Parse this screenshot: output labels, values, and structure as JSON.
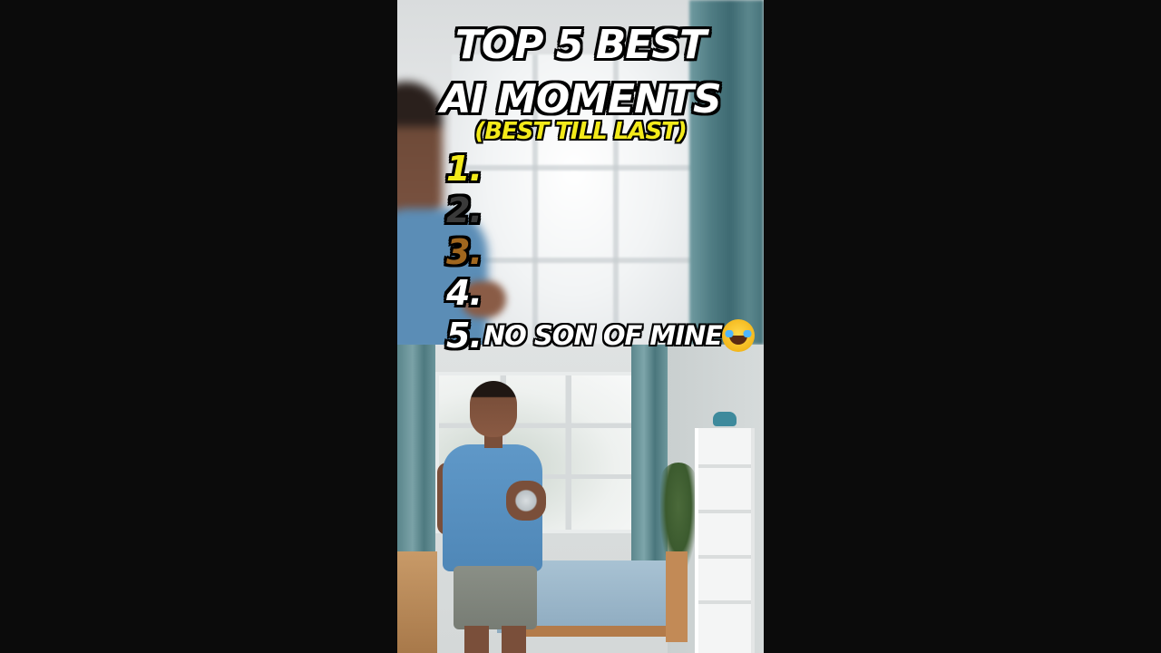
{
  "video": {
    "title_line1": "TOP 5 BEST",
    "title_line2": "AI MOMENTS",
    "subtitle": "(BEST TILL LAST)",
    "ranks": [
      {
        "number": "1.",
        "label": "",
        "color": "#f3ea1a"
      },
      {
        "number": "2.",
        "label": "",
        "color": "#3a3a3a"
      },
      {
        "number": "3.",
        "label": "",
        "color": "#a0661e"
      },
      {
        "number": "4.",
        "label": "",
        "color": "#ffffff"
      },
      {
        "number": "5.",
        "label": "NO SON OF MINE",
        "color": "#ffffff",
        "emoji": "face-with-tears-of-joy"
      }
    ]
  },
  "colors": {
    "background": "#0b0b0b",
    "title_text": "#ffffff",
    "subtitle_text": "#f3ea1a"
  }
}
